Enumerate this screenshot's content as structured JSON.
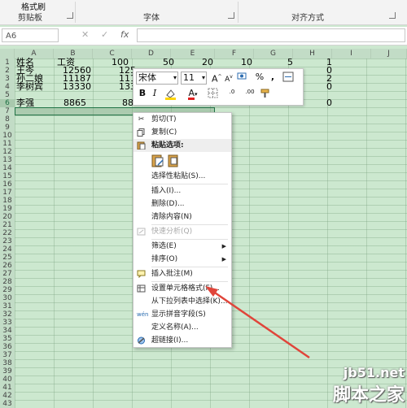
{
  "ribbon": {
    "clipboard_btn": "格式刷",
    "groups": [
      "剪贴板",
      "字体",
      "对齐方式"
    ]
  },
  "formula_bar": {
    "name_box": "A6",
    "cancel_icon": "✕",
    "enter_icon": "✓",
    "fx_icon": "fx"
  },
  "columns": [
    "A",
    "B",
    "C",
    "D",
    "E",
    "F",
    "G",
    "H",
    "I",
    "J"
  ],
  "rows": [
    "1",
    "2",
    "3",
    "4",
    "5",
    "6",
    "7",
    "8",
    "9",
    "10",
    "11",
    "12",
    "13",
    "14",
    "15",
    "16",
    "17",
    "18",
    "19",
    "20",
    "21",
    "22",
    "23",
    "24",
    "25",
    "26",
    "27",
    "28",
    "29",
    "30",
    "31",
    "32",
    "33",
    "34",
    "35",
    "36",
    "37",
    "38",
    "39",
    "40",
    "41",
    "42",
    "43"
  ],
  "sheet": {
    "r1": {
      "a": "姓名",
      "b": "工资",
      "c": "100",
      "d": "50",
      "e": "20",
      "f": "10",
      "g": "5",
      "h": "1"
    },
    "r2": {
      "a": "王岑",
      "b": "12560",
      "c": "125",
      "h": "0"
    },
    "r3": {
      "a": "孙二娘",
      "b": "11187",
      "c": "111",
      "h": "2"
    },
    "r4": {
      "a": "李树宾",
      "b": "13330",
      "c": "133",
      "h": "0"
    },
    "r5": {
      "a": "李强",
      "b": "8865",
      "c": "88",
      "h": "0"
    }
  },
  "mini_toolbar": {
    "font_name": "宋体",
    "font_size": "11",
    "grow_font": "A",
    "shrink_font": "A",
    "percent": "%",
    "comma": ",",
    "bold": "B",
    "italic": "I",
    "font_color": "A",
    "inc_decimal": ".0",
    "dec_decimal": ".00"
  },
  "context_menu": {
    "cut": "剪切(T)",
    "copy": "复制(C)",
    "paste_options": "粘贴选项:",
    "paste_special": "选择性粘贴(S)...",
    "insert": "插入(I)...",
    "delete": "删除(D)...",
    "clear_contents": "清除内容(N)",
    "quick_analysis": "快速分析(Q)",
    "filter": "筛选(E)",
    "sort": "排序(O)",
    "insert_comment": "插入批注(M)",
    "format_cells": "设置单元格格式(F)...",
    "pick_from_list": "从下拉列表中选择(K)...",
    "phonetic": "显示拼音字段(S)",
    "define_name": "定义名称(A)...",
    "hyperlink": "超链接(I)..."
  },
  "watermark": {
    "url": "jb51.net",
    "name": "脚本之家"
  },
  "colors": {
    "sheet_bg": "#cce8cf",
    "accent_green": "#217346",
    "arrow_red": "#e0453a"
  }
}
